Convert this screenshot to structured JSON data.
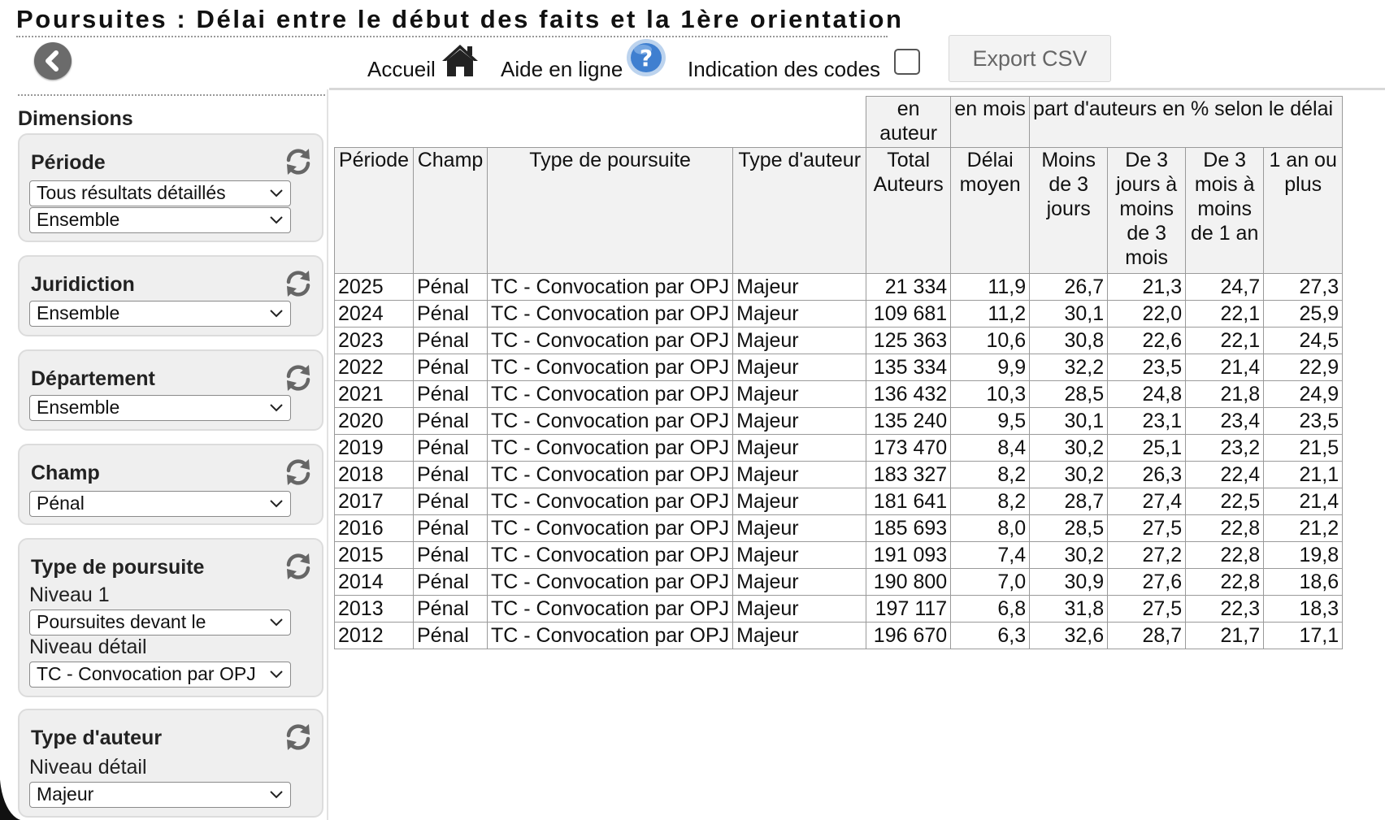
{
  "header": {
    "title": "Poursuites : Délai entre le début des faits et la 1ère orientation",
    "links": {
      "home": "Accueil",
      "help": "Aide en ligne",
      "codes": "Indication des codes"
    },
    "codes_checked": false,
    "export_label": "Export CSV"
  },
  "sidebar": {
    "heading": "Dimensions",
    "panels": [
      {
        "title": "Période",
        "selects": [
          "Tous résultats détaillés",
          "Ensemble"
        ]
      },
      {
        "title": "Juridiction",
        "selects": [
          "Ensemble"
        ]
      },
      {
        "title": "Département",
        "selects": [
          "Ensemble"
        ]
      },
      {
        "title": "Champ",
        "selects": [
          "Pénal"
        ]
      },
      {
        "title": "Type de poursuite",
        "level1_label": "Niveau 1",
        "level1_value": "Poursuites devant le",
        "detail_label": "Niveau détail",
        "detail_value": "TC - Convocation par OPJ"
      },
      {
        "title": "Type d'auteur",
        "detail_label": "Niveau détail",
        "detail_value": "Majeur"
      }
    ]
  },
  "table": {
    "group_headers": {
      "unit_authors": "en auteur",
      "unit_months": "en mois",
      "share": "part d'auteurs en % selon le délai"
    },
    "columns": [
      "Période",
      "Champ",
      "Type de poursuite",
      "Type d'auteur",
      "Total Auteurs",
      "Délai moyen",
      "Moins de 3 jours",
      "De 3 jours à moins de 3 mois",
      "De 3 mois à moins de 1 an",
      "1 an ou plus"
    ],
    "rows": [
      [
        "2025",
        "Pénal",
        "TC - Convocation par OPJ",
        "Majeur",
        "21 334",
        "11,9",
        "26,7",
        "21,3",
        "24,7",
        "27,3"
      ],
      [
        "2024",
        "Pénal",
        "TC - Convocation par OPJ",
        "Majeur",
        "109 681",
        "11,2",
        "30,1",
        "22,0",
        "22,1",
        "25,9"
      ],
      [
        "2023",
        "Pénal",
        "TC - Convocation par OPJ",
        "Majeur",
        "125 363",
        "10,6",
        "30,8",
        "22,6",
        "22,1",
        "24,5"
      ],
      [
        "2022",
        "Pénal",
        "TC - Convocation par OPJ",
        "Majeur",
        "135 334",
        "9,9",
        "32,2",
        "23,5",
        "21,4",
        "22,9"
      ],
      [
        "2021",
        "Pénal",
        "TC - Convocation par OPJ",
        "Majeur",
        "136 432",
        "10,3",
        "28,5",
        "24,8",
        "21,8",
        "24,9"
      ],
      [
        "2020",
        "Pénal",
        "TC - Convocation par OPJ",
        "Majeur",
        "135 240",
        "9,5",
        "30,1",
        "23,1",
        "23,4",
        "23,5"
      ],
      [
        "2019",
        "Pénal",
        "TC - Convocation par OPJ",
        "Majeur",
        "173 470",
        "8,4",
        "30,2",
        "25,1",
        "23,2",
        "21,5"
      ],
      [
        "2018",
        "Pénal",
        "TC - Convocation par OPJ",
        "Majeur",
        "183 327",
        "8,2",
        "30,2",
        "26,3",
        "22,4",
        "21,1"
      ],
      [
        "2017",
        "Pénal",
        "TC - Convocation par OPJ",
        "Majeur",
        "181 641",
        "8,2",
        "28,7",
        "27,4",
        "22,5",
        "21,4"
      ],
      [
        "2016",
        "Pénal",
        "TC - Convocation par OPJ",
        "Majeur",
        "185 693",
        "8,0",
        "28,5",
        "27,5",
        "22,8",
        "21,2"
      ],
      [
        "2015",
        "Pénal",
        "TC - Convocation par OPJ",
        "Majeur",
        "191 093",
        "7,4",
        "30,2",
        "27,2",
        "22,8",
        "19,8"
      ],
      [
        "2014",
        "Pénal",
        "TC - Convocation par OPJ",
        "Majeur",
        "190 800",
        "7,0",
        "30,9",
        "27,6",
        "22,8",
        "18,6"
      ],
      [
        "2013",
        "Pénal",
        "TC - Convocation par OPJ",
        "Majeur",
        "197 117",
        "6,8",
        "31,8",
        "27,5",
        "22,3",
        "18,3"
      ],
      [
        "2012",
        "Pénal",
        "TC - Convocation par OPJ",
        "Majeur",
        "196 670",
        "6,3",
        "32,6",
        "28,7",
        "21,7",
        "17,1"
      ]
    ]
  }
}
